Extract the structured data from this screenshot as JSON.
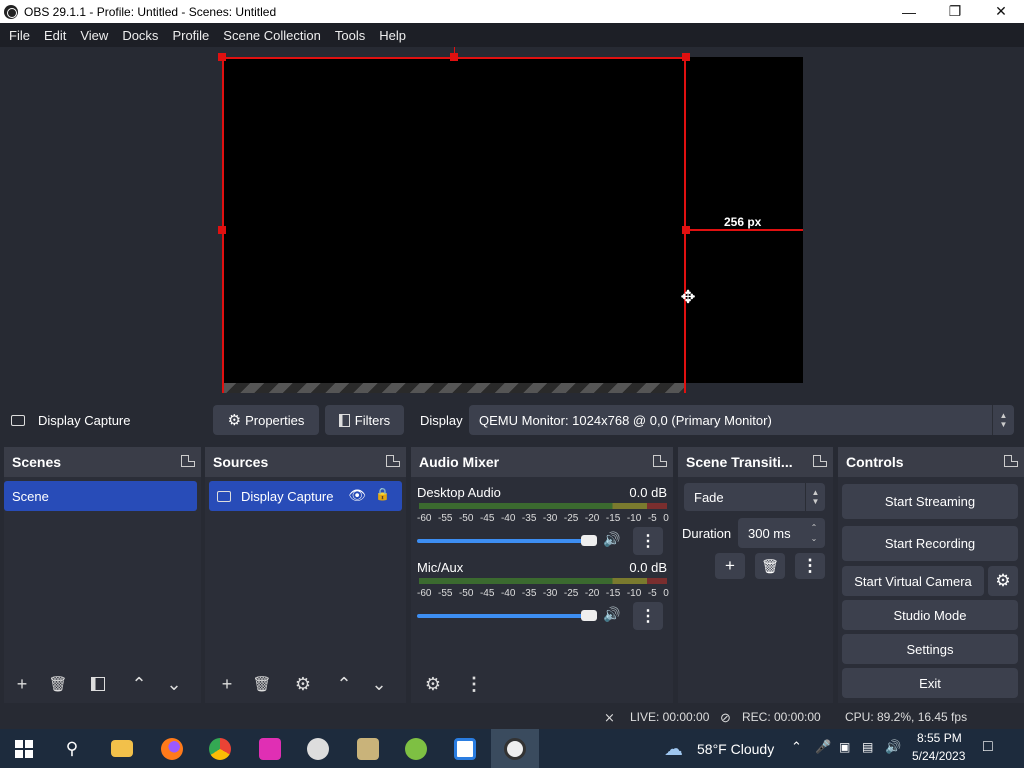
{
  "window": {
    "title": "OBS 29.1.1 - Profile: Untitled - Scenes: Untitled"
  },
  "menu": [
    "File",
    "Edit",
    "View",
    "Docks",
    "Profile",
    "Scene Collection",
    "Tools",
    "Help"
  ],
  "preview": {
    "distance_label": "256 px"
  },
  "source_toolbar": {
    "source_name": "Display Capture",
    "properties_label": "Properties",
    "filters_label": "Filters",
    "display_label": "Display",
    "display_value": "QEMU Monitor: 1024x768 @ 0,0 (Primary Monitor)"
  },
  "scenes": {
    "title": "Scenes",
    "items": [
      "Scene"
    ]
  },
  "sources": {
    "title": "Sources",
    "items": [
      "Display Capture"
    ]
  },
  "audio_mixer": {
    "title": "Audio Mixer",
    "scale": [
      "-60",
      "-55",
      "-50",
      "-45",
      "-40",
      "-35",
      "-30",
      "-25",
      "-20",
      "-15",
      "-10",
      "-5",
      "0"
    ],
    "channels": [
      {
        "name": "Desktop Audio",
        "db": "0.0 dB",
        "volume": 1.0
      },
      {
        "name": "Mic/Aux",
        "db": "0.0 dB",
        "volume": 1.0
      }
    ]
  },
  "transitions": {
    "title": "Scene Transiti...",
    "selected": "Fade",
    "duration_label": "Duration",
    "duration_value": "300 ms"
  },
  "controls": {
    "title": "Controls",
    "start_streaming": "Start Streaming",
    "start_recording": "Start Recording",
    "start_virtual_camera": "Start Virtual Camera",
    "studio_mode": "Studio Mode",
    "settings": "Settings",
    "exit": "Exit"
  },
  "status": {
    "live": "LIVE: 00:00:00",
    "rec": "REC: 00:00:00",
    "cpu": "CPU: 89.2%, 16.45 fps"
  },
  "taskbar": {
    "weather": "58°F  Cloudy",
    "time": "8:55 PM",
    "date": "5/24/2023"
  }
}
